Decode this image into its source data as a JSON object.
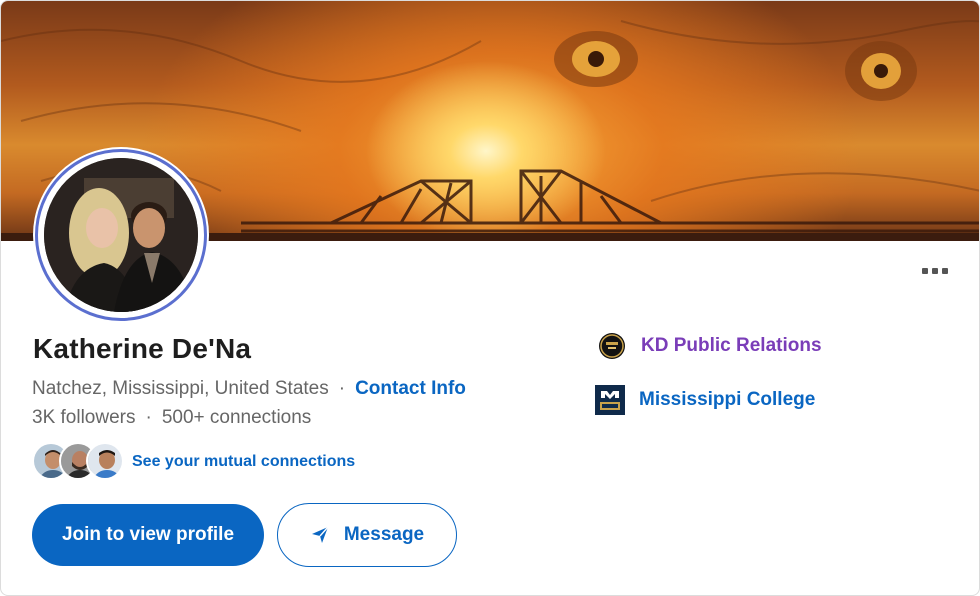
{
  "profile": {
    "name": "Katherine De'Na",
    "location": "Natchez, Mississippi, United States",
    "separator": "·",
    "contact_info_label": "Contact Info",
    "followers": "3K followers",
    "connections": "500+ connections"
  },
  "mutual": {
    "label": "See your mutual connections"
  },
  "actions": {
    "join_label": "Join to view profile",
    "message_label": "Message"
  },
  "affiliations": [
    {
      "name": "KD Public Relations",
      "icon": "kd-public-relations-logo-icon"
    },
    {
      "name": "Mississippi College",
      "icon": "mississippi-college-logo-icon"
    }
  ],
  "colors": {
    "accent": "#0a66c2",
    "visited_link": "#7a3db8",
    "secondary_text": "#666666",
    "primary_text": "#1e1e1e"
  },
  "icons": {
    "more": "more-options-icon",
    "message": "send-icon"
  }
}
